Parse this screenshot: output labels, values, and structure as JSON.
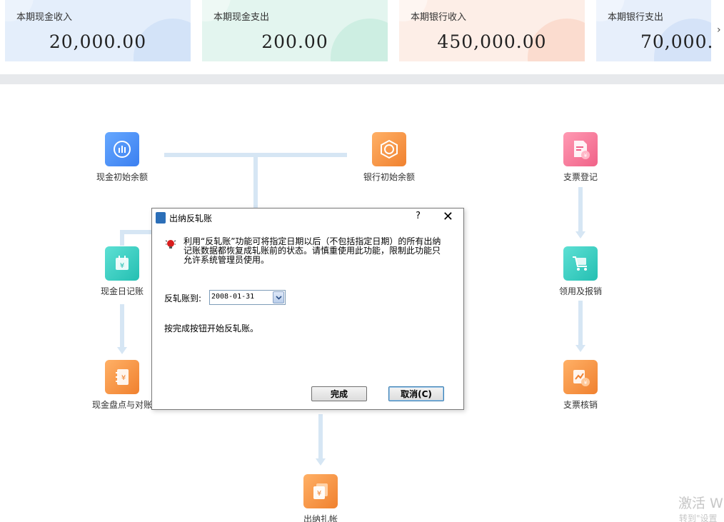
{
  "summary_cards": [
    {
      "label": "本期现金收入",
      "value": "20,000.00"
    },
    {
      "label": "本期现金支出",
      "value": "200.00"
    },
    {
      "label": "本期银行收入",
      "value": "450,000.00"
    },
    {
      "label": "本期银行支出",
      "value": "70,000."
    }
  ],
  "next_arrow": "›",
  "flow": {
    "cash_opening": "现金初始余额",
    "bank_opening": "银行初始余额",
    "cheque_register": "支票登记",
    "cash_journal": "现金日记账",
    "receive_reimburse": "领用及报销",
    "cash_count_reconcile": "现金盘点与对账",
    "cheque_writeoff": "支票核销",
    "cashier_close": "出纳扎帐"
  },
  "dialog": {
    "title": "出纳反轧账",
    "help": "?",
    "close": "✕",
    "message": "利用“反轧账”功能可将指定日期以后（不包括指定日期）的所有出纳记账数据都恢复成轧账前的状态。请慎重使用此功能，限制此功能只允许系统管理员使用。",
    "date_label": "反轧账到:",
    "date_value": "2008-01-31",
    "hint": "按完成按钮开始反轧账。",
    "btn_done": "完成",
    "btn_cancel": "取消(C)"
  },
  "watermark": {
    "line1": "激活 W",
    "line2": "转到\"设置"
  },
  "colors": {
    "card_blue": "#e4eefb",
    "card_green": "#e3f5ef",
    "card_orange": "#fdeee7",
    "flow_line": "#d6e6f4"
  }
}
